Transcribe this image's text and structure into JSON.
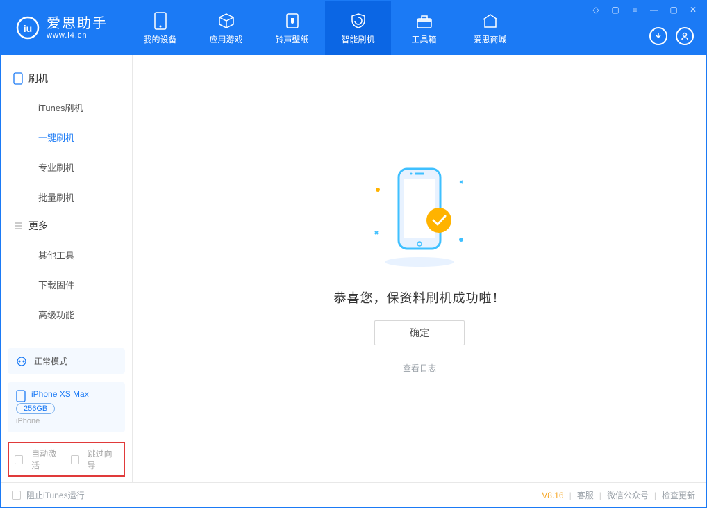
{
  "app": {
    "name": "爱思助手",
    "url": "www.i4.cn"
  },
  "nav": {
    "items": [
      {
        "label": "我的设备",
        "icon": "device-icon"
      },
      {
        "label": "应用游戏",
        "icon": "cube-icon"
      },
      {
        "label": "铃声壁纸",
        "icon": "music-icon"
      },
      {
        "label": "智能刷机",
        "icon": "shield-icon",
        "active": true
      },
      {
        "label": "工具箱",
        "icon": "toolbox-icon"
      },
      {
        "label": "爱思商城",
        "icon": "house-icon"
      }
    ]
  },
  "sidebar": {
    "section_flash": {
      "title": "刷机",
      "items": [
        "iTunes刷机",
        "一键刷机",
        "专业刷机",
        "批量刷机"
      ],
      "active_index": 1
    },
    "section_more": {
      "title": "更多",
      "items": [
        "其他工具",
        "下载固件",
        "高级功能"
      ]
    }
  },
  "device": {
    "mode": "正常模式",
    "model": "iPhone XS Max",
    "storage": "256GB",
    "type": "iPhone"
  },
  "options": {
    "auto_activate": "自动激活",
    "skip_guide": "跳过向导"
  },
  "main": {
    "success_text": "恭喜您，保资料刷机成功啦！",
    "ok_label": "确定",
    "view_log_label": "查看日志"
  },
  "footer": {
    "block_itunes": "阻止iTunes运行",
    "version": "V8.16",
    "links": [
      "客服",
      "微信公众号",
      "检查更新"
    ]
  }
}
